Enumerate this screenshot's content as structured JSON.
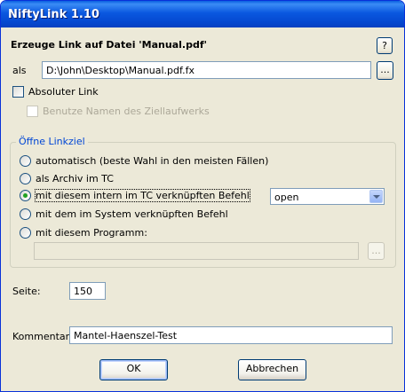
{
  "window": {
    "title": "NiftyLink 1.10"
  },
  "header": {
    "heading": "Erzeuge Link auf Datei 'Manual.pdf'",
    "help_label": "?"
  },
  "target": {
    "label": "als",
    "value": "D:\\John\\Desktop\\Manual.pdf.fx",
    "browse_label": "..."
  },
  "options": {
    "absolute_link_label": "Absoluter Link",
    "absolute_link_checked": false,
    "drive_names_label": "Benutze Namen des Ziellaufwerks",
    "drive_names_checked": false
  },
  "open_group": {
    "title": "Öffne Linkziel",
    "radios": [
      {
        "label": "automatisch (beste Wahl in den meisten Fällen)",
        "selected": false
      },
      {
        "label": "als Archiv im TC",
        "selected": false
      },
      {
        "label": "mit diesem intern im TC verknüpften Befehl",
        "selected": true
      },
      {
        "label": "mit dem im System verknüpften Befehl",
        "selected": false
      },
      {
        "label": "mit diesem Programm:",
        "selected": false
      }
    ],
    "command_select": {
      "value": "open"
    },
    "program": {
      "value": "",
      "browse_label": "..."
    }
  },
  "page": {
    "label": "Seite:",
    "value": "150"
  },
  "comment": {
    "label": "Kommentar:",
    "value": "Mantel-Haenszel-Test"
  },
  "buttons": {
    "ok": "OK",
    "cancel": "Abbrechen"
  },
  "colors": {
    "title_bar": "#0a58e0",
    "dialog_bg": "#ece9d8",
    "group_title": "#0046d5",
    "radio_dot": "#21a121"
  }
}
